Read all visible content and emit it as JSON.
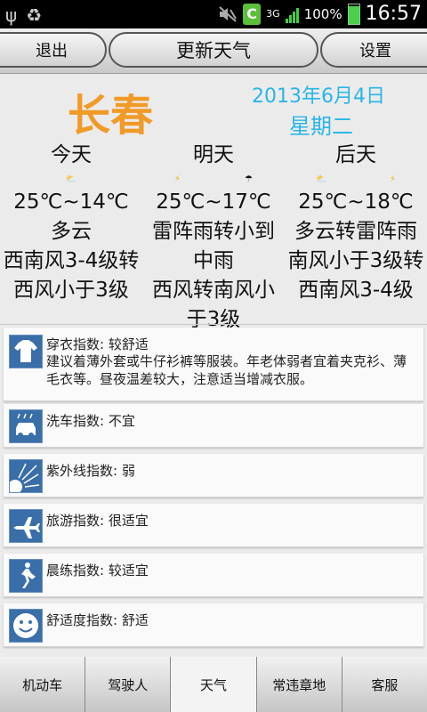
{
  "status_bar": {
    "usb_icon": "usb-icon",
    "recycle_icon": "recycle-icon",
    "mute_icon": "mute-icon",
    "app_badge": "C",
    "network": "3G",
    "battery_percent": "100%",
    "time": "16:57",
    "colors": {
      "signal": "#3fd13f",
      "app_badge": "#5bbf3a"
    }
  },
  "toolbar": {
    "back_label": "退出",
    "title": "更新天气",
    "settings_label": "设置"
  },
  "location": {
    "city": "长春",
    "date": "2013年6月4日",
    "weekday": "星期二",
    "colors": {
      "city": "#f09a28",
      "date": "#29b6e6"
    }
  },
  "forecast": [
    {
      "day": "今天",
      "temp": "25℃~14℃",
      "weather_lines": [
        "多云"
      ],
      "wind_lines": [
        "西南风3-4级转",
        "西风小于3级"
      ],
      "icons": [
        "cloudy-icon"
      ]
    },
    {
      "day": "明天",
      "temp": "25℃~17℃",
      "weather_lines": [
        "雷阵雨转小到",
        "中雨"
      ],
      "wind_lines": [
        "西风转南风小",
        "于3级"
      ],
      "icons": [
        "thunderstorm-icon",
        "rain-icon"
      ]
    },
    {
      "day": "后天",
      "temp": "25℃~18℃",
      "weather_lines": [
        "多云转雷阵雨"
      ],
      "wind_lines": [
        "南风小于3级转",
        "西南风3-4级"
      ],
      "icons": [
        "cloudy-icon",
        "thunderstorm-icon"
      ]
    }
  ],
  "indices": [
    {
      "icon": "shirt-icon",
      "title": "穿衣指数: 较舒适",
      "desc": "建议着薄外套或牛仔衫裤等服装。年老体弱者宜着夹克衫、薄毛衣等。昼夜温差较大，注意适当增减衣服。"
    },
    {
      "icon": "car-wash-icon",
      "title": "洗车指数: 不宜",
      "desc": ""
    },
    {
      "icon": "uv-sun-icon",
      "title": "紫外线指数: 弱",
      "desc": ""
    },
    {
      "icon": "airplane-icon",
      "title": "旅游指数: 很适宜",
      "desc": ""
    },
    {
      "icon": "runner-icon",
      "title": "晨练指数: 较适宜",
      "desc": ""
    },
    {
      "icon": "smiley-icon",
      "title": "舒适度指数: 舒适",
      "desc": ""
    }
  ],
  "tabs": [
    {
      "label": "机动车",
      "active": false
    },
    {
      "label": "驾驶人",
      "active": false
    },
    {
      "label": "天气",
      "active": true
    },
    {
      "label": "常违章地",
      "active": false
    },
    {
      "label": "客服",
      "active": false
    }
  ]
}
